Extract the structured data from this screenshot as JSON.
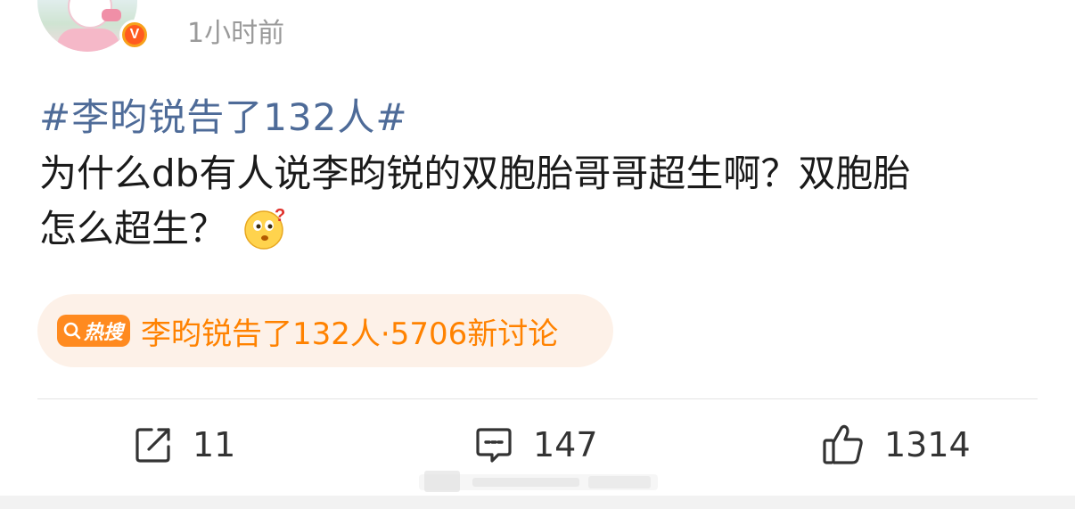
{
  "post": {
    "time": "1小时前",
    "hashtag": "#李昀锐告了132人#",
    "body_line1": "为什么db有人说李昀锐的双胞胎哥哥超生啊？双胞胎",
    "body_line2": "怎么超生？",
    "emoji": "thinking-face-icon"
  },
  "hot_search": {
    "badge_label": "热搜",
    "text": "李昀锐告了132人·5706新讨论",
    "color": "#ff8200",
    "background": "#fdf1e8"
  },
  "actions": {
    "share_count": "11",
    "comment_count": "147",
    "like_count": "1314"
  },
  "colors": {
    "hashtag": "#4e6b98",
    "time": "#9a9a9a",
    "verified_badge": "#ff5a1f"
  }
}
